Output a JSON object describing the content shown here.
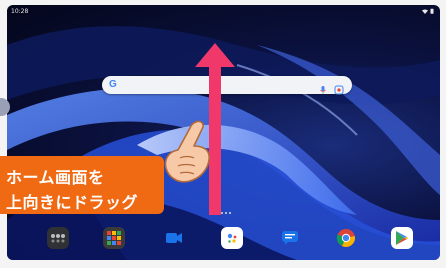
{
  "status_bar": {
    "time": "10:28",
    "icons": [
      "wifi-icon",
      "battery-icon"
    ]
  },
  "search_bar": {
    "logo": "G",
    "icons": [
      "mic-icon",
      "lens-icon"
    ]
  },
  "gesture": {
    "arrow_color": "#f0386b",
    "direction": "up"
  },
  "callout": {
    "line1": "ホーム画面を",
    "line2": "上向きにドラッグ",
    "background": "#f06a14"
  },
  "dock": {
    "apps": [
      "folder-app",
      "app-grid-app",
      "meet-app",
      "assistant-app",
      "messages-app",
      "chrome-app",
      "play-store-app"
    ]
  },
  "colors": {
    "accent_pink": "#f0386b",
    "callout_orange": "#f06a14",
    "wallpaper_dark": "#04061a",
    "wallpaper_blue": "#2b4fd8"
  }
}
